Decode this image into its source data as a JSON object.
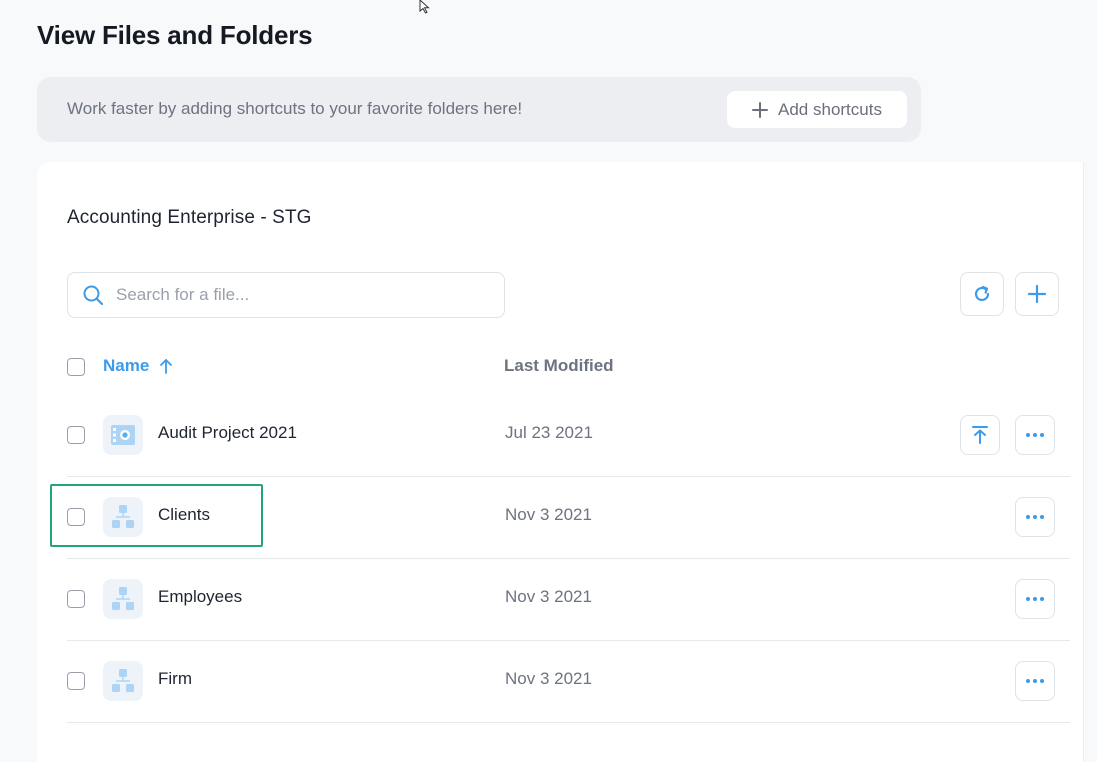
{
  "page": {
    "title": "View Files and Folders"
  },
  "shortcuts": {
    "message": "Work faster by adding shortcuts to your favorite folders here!",
    "add_label": "Add shortcuts"
  },
  "panel": {
    "title": "Accounting Enterprise - STG"
  },
  "search": {
    "placeholder": "Search for a file...",
    "value": ""
  },
  "table": {
    "columns": {
      "name": "Name",
      "last_modified": "Last Modified"
    },
    "sort": {
      "column": "name",
      "direction": "ascending"
    },
    "rows": [
      {
        "name": "Audit Project 2021",
        "modified": "Jul 23 2021",
        "icon": "project-icon",
        "has_upload": true
      },
      {
        "name": "Clients",
        "modified": "Nov 3 2021",
        "icon": "folder-tree-icon",
        "has_upload": false,
        "highlighted": true
      },
      {
        "name": "Employees",
        "modified": "Nov 3 2021",
        "icon": "folder-tree-icon",
        "has_upload": false
      },
      {
        "name": "Firm",
        "modified": "Nov 3 2021",
        "icon": "folder-tree-icon",
        "has_upload": false
      }
    ]
  },
  "colors": {
    "accent": "#3d9be9",
    "highlight": "#21a67a",
    "icon_light": "#aed4f5"
  }
}
